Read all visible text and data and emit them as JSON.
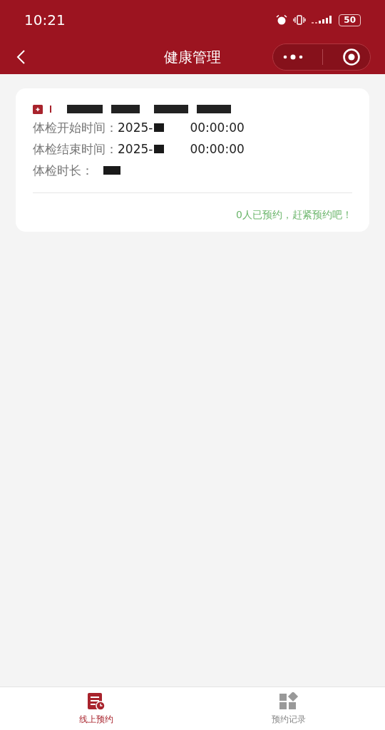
{
  "status_bar": {
    "time": "10:21",
    "battery": "50"
  },
  "nav_bar": {
    "title": "健康管理"
  },
  "card": {
    "rows": [
      {
        "label": "体检开始时间：",
        "value_start": "2025-",
        "value_end": "00:00:00"
      },
      {
        "label": "体检结束时间：",
        "value_start": "2025-",
        "value_end": "00:00:00"
      },
      {
        "label": "体检时长："
      }
    ],
    "footer": "0人已预约，赶紧预约吧！"
  },
  "tab_bar": [
    {
      "label": "线上预约",
      "selected": true,
      "kind": "list"
    },
    {
      "label": "预约记录",
      "selected": false,
      "kind": "grid"
    }
  ]
}
